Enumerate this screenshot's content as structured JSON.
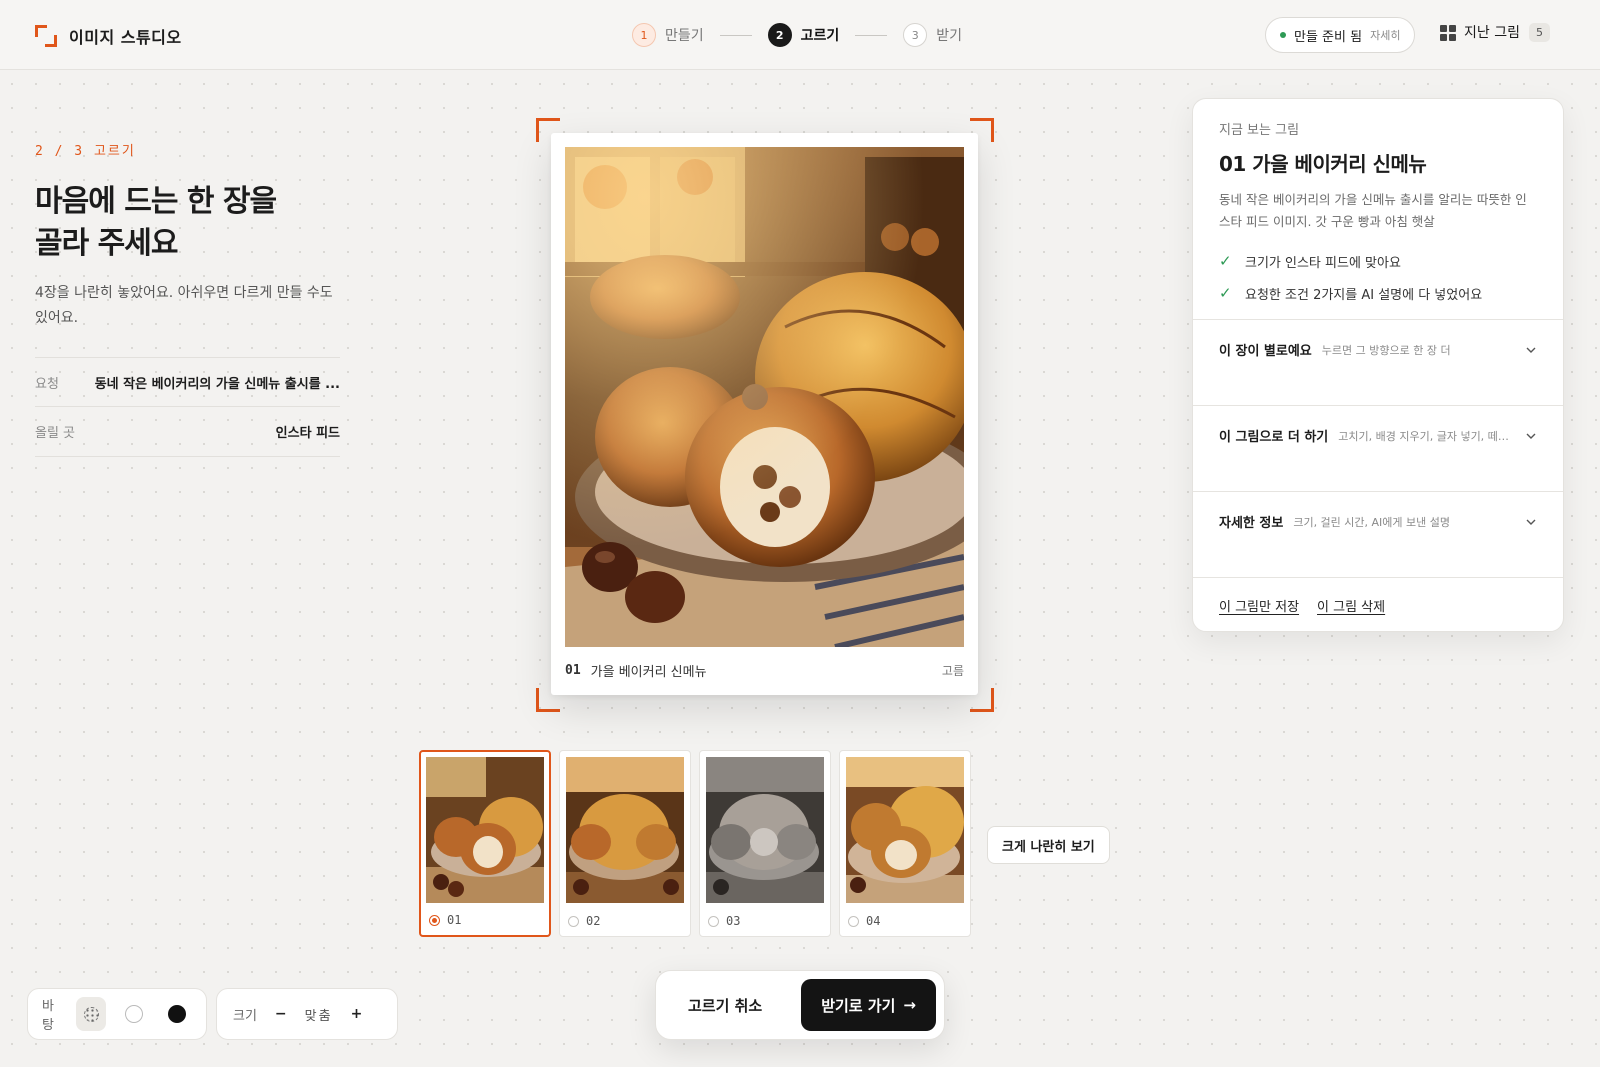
{
  "app": {
    "title": "이미지 스튜디오",
    "logo_icon": "corner-brackets-logo",
    "accent": "#e0561a"
  },
  "stepper": [
    {
      "num": "1",
      "label": "만들기",
      "state": "done"
    },
    {
      "num": "2",
      "label": "고르기",
      "state": "active"
    },
    {
      "num": "3",
      "label": "받기",
      "state": "todo"
    }
  ],
  "header": {
    "status_label": "만들 준비 됨",
    "status_detail": "자세히",
    "status_color": "#2e9a55",
    "history_label": "지난 그림",
    "history_count": "5"
  },
  "intro": {
    "step_caption": "2 / 3 고르기",
    "headline_line1": "마음에 드는 한 장을",
    "headline_line2": "골라 주세요",
    "subtext": "4장을 나란히 놓았어요. 아쉬우면 다르게 만들 수도 있어요.",
    "meta": [
      {
        "label": "요청",
        "value": "동네 작은 베이커리의 가을 신메뉴 출시를 ..."
      },
      {
        "label": "올릴 곳",
        "value": "인스타 피드"
      }
    ]
  },
  "preview": {
    "number": "01",
    "title": "가을 베이커리 신메뉴",
    "status": "고름"
  },
  "thumbnails": [
    {
      "id": "01",
      "selected": true,
      "tone": "normal"
    },
    {
      "id": "02",
      "selected": false,
      "tone": "warm"
    },
    {
      "id": "03",
      "selected": false,
      "tone": "grey"
    },
    {
      "id": "04",
      "selected": false,
      "tone": "bright"
    }
  ],
  "compare_button": "크게 나란히 보기",
  "panel": {
    "eyebrow": "지금 보는 그림",
    "title": "01 가을 베이커리 신메뉴",
    "description": "동네 작은 베이커리의 가을 신메뉴 출시를 알리는 따뜻한 인스타 피드 이미지. 갓 구운 빵과 아침 햇살",
    "checks": [
      "크기가 인스타 피드에 맞아요",
      "요청한 조건 2가지를 AI 설명에 다 넣었어요"
    ],
    "accordions": [
      {
        "title": "이 장이 별로예요",
        "hint": "누르면 그 방향으로 한 장 더"
      },
      {
        "title": "이 그림으로 더 하기",
        "hint": "고치기, 배경 지우기, 글자 넣기, 떼어..."
      },
      {
        "title": "자세한 정보",
        "hint": "크기, 걸린 시간, AI에게 보낸 설명"
      }
    ],
    "links": {
      "save_only": "이 그림만 저장",
      "delete": "이 그림 삭제"
    }
  },
  "actions": {
    "cancel": "고르기 취소",
    "proceed": "받기로 가기",
    "proceed_icon": "arrow-right-icon"
  },
  "toolbar": {
    "background_label": "바탕",
    "background_options": [
      "dot-grid",
      "white",
      "black"
    ],
    "background_selected": "dot-grid",
    "size_label": "크기",
    "zoom_minus": "−",
    "zoom_fit": "맞춤",
    "zoom_plus": "+"
  }
}
